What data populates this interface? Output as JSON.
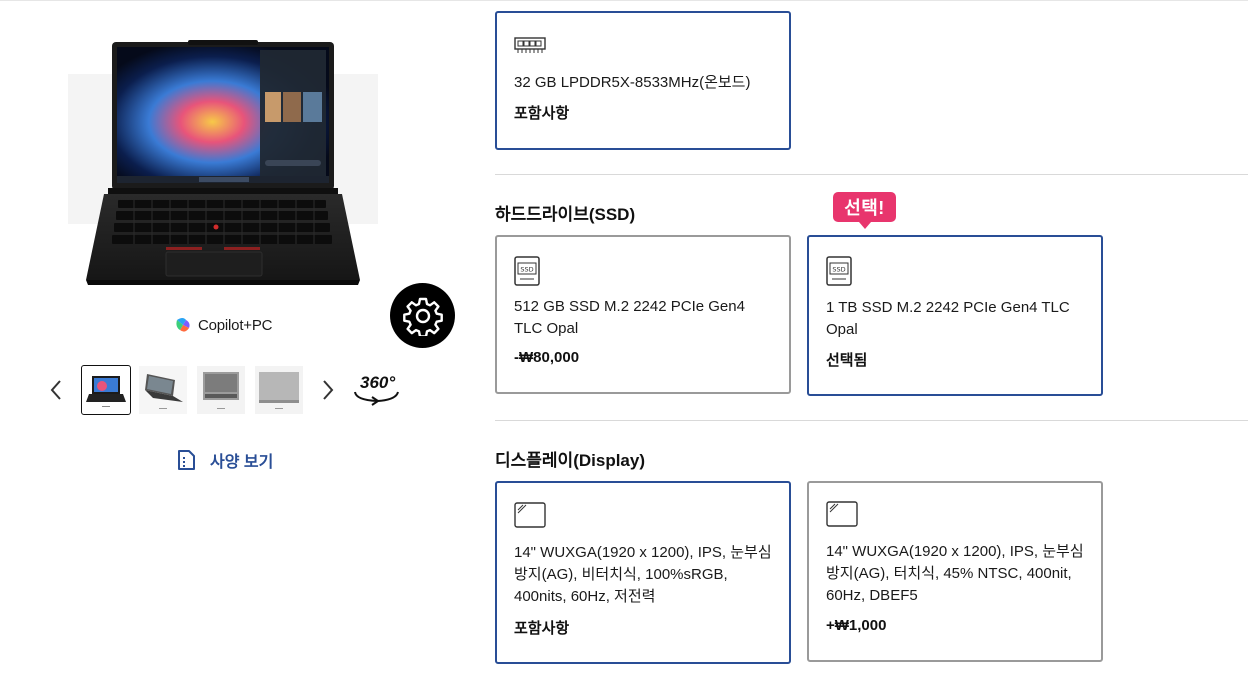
{
  "gallery": {
    "copilot_label": "Copilot+PC",
    "view360_label": "360°",
    "spec_link": "사양 보기",
    "thumbnail_count": 4
  },
  "memory_card": {
    "description": "32 GB LPDDR5X-8533MHz(온보드)",
    "price": "포함사항",
    "selected": true
  },
  "storage": {
    "title": "하드드라이브(SSD)",
    "badge": "선택!",
    "options": [
      {
        "description": "512 GB SSD M.2 2242 PCIe Gen4 TLC Opal",
        "price": "-₩80,000",
        "selected": false
      },
      {
        "description": "1 TB SSD M.2 2242 PCIe Gen4 TLC Opal",
        "price": "선택됨",
        "selected": true
      }
    ]
  },
  "display": {
    "title": "디스플레이(Display)",
    "options": [
      {
        "description": "14\" WUXGA(1920 x 1200), IPS, 눈부심 방지(AG), 비터치식, 100%sRGB, 400nits, 60Hz, 저전력",
        "price": "포함사항",
        "selected": true
      },
      {
        "description": "14\" WUXGA(1920 x 1200), IPS, 눈부심 방지(AG), 터치식, 45% NTSC, 400nit, 60Hz, DBEF5",
        "price": "+₩1,000",
        "selected": false
      }
    ]
  },
  "colors": {
    "selected_border": "#294e96",
    "default_border": "#9a9a9a",
    "badge": "#e8356d",
    "link": "#294e96"
  }
}
